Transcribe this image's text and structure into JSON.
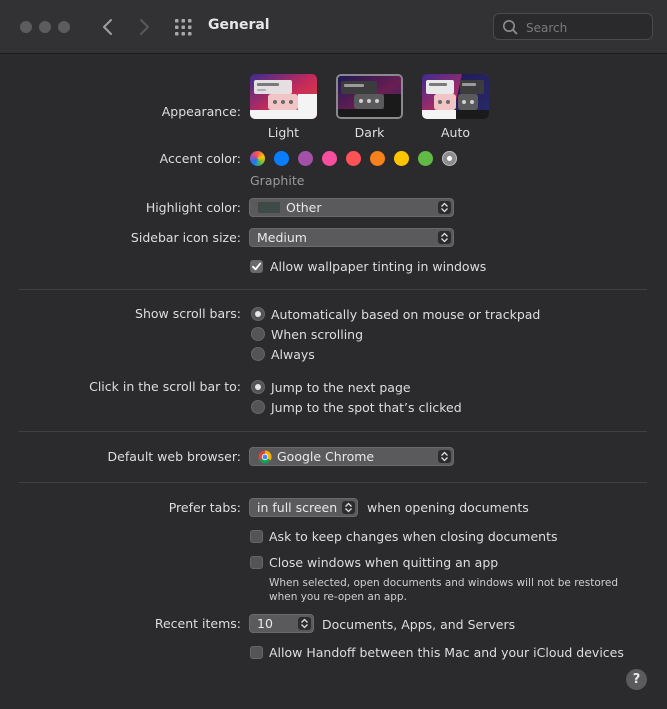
{
  "window": {
    "title": "General",
    "search_placeholder": "Search"
  },
  "appearance": {
    "label": "Appearance:",
    "options": [
      {
        "label": "Light",
        "selected": false
      },
      {
        "label": "Dark",
        "selected": true
      },
      {
        "label": "Auto",
        "selected": false
      }
    ]
  },
  "accent": {
    "label": "Accent color:",
    "colors": [
      "multicolor",
      "#0a7cff",
      "#a550a7",
      "#f74f9e",
      "#ff5257",
      "#f7821b",
      "#ffc600",
      "#62ba46",
      "#8c8c8c"
    ],
    "selected_name": "Graphite"
  },
  "highlight": {
    "label": "Highlight color:",
    "value": "Other",
    "swatch": "#3e4a46"
  },
  "sidebar_icon": {
    "label": "Sidebar icon size:",
    "value": "Medium"
  },
  "wallpaper_tinting": {
    "label": "Allow wallpaper tinting in windows",
    "checked": true
  },
  "scroll_bars": {
    "label": "Show scroll bars:",
    "options": [
      {
        "label": "Automatically based on mouse or trackpad",
        "selected": true
      },
      {
        "label": "When scrolling",
        "selected": false
      },
      {
        "label": "Always",
        "selected": false
      }
    ]
  },
  "scroll_click": {
    "label": "Click in the scroll bar to:",
    "options": [
      {
        "label": "Jump to the next page",
        "selected": true
      },
      {
        "label": "Jump to the spot that’s clicked",
        "selected": false
      }
    ]
  },
  "browser": {
    "label": "Default web browser:",
    "value": "Google Chrome"
  },
  "prefer_tabs": {
    "label": "Prefer tabs:",
    "value": "in full screen",
    "suffix": "when opening documents"
  },
  "ask_keep": {
    "label": "Ask to keep changes when closing documents",
    "checked": false
  },
  "close_windows": {
    "label": "Close windows when quitting an app",
    "checked": false,
    "note_line1": "When selected, open documents and windows will not be restored",
    "note_line2": "when you re-open an app."
  },
  "recent": {
    "label": "Recent items:",
    "value": "10",
    "suffix": "Documents, Apps, and Servers"
  },
  "handoff": {
    "label": "Allow Handoff between this Mac and your iCloud devices",
    "checked": false
  },
  "help": "?"
}
